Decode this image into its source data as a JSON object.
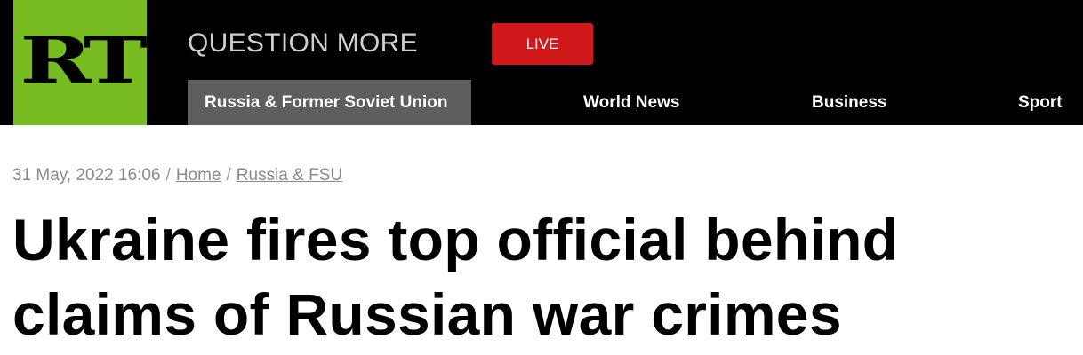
{
  "header": {
    "logo_text": "RT",
    "tagline": "QUESTION MORE",
    "live_label": "LIVE",
    "nav": [
      {
        "label": "Russia & Former Soviet Union",
        "active": true
      },
      {
        "label": "World News",
        "active": false
      },
      {
        "label": "Business",
        "active": false
      },
      {
        "label": "Sport",
        "active": false
      }
    ]
  },
  "article": {
    "date": "31 May, 2022 16:06",
    "separator": "/",
    "breadcrumbs": [
      "Home",
      "Russia & FSU"
    ],
    "headline": "Ukraine fires top official behind claims of Russian war crimes"
  },
  "colors": {
    "brand_green": "#77bd22",
    "live_red": "#d1191c",
    "header_bg": "#000000",
    "active_nav_bg": "#5e5e5e"
  }
}
